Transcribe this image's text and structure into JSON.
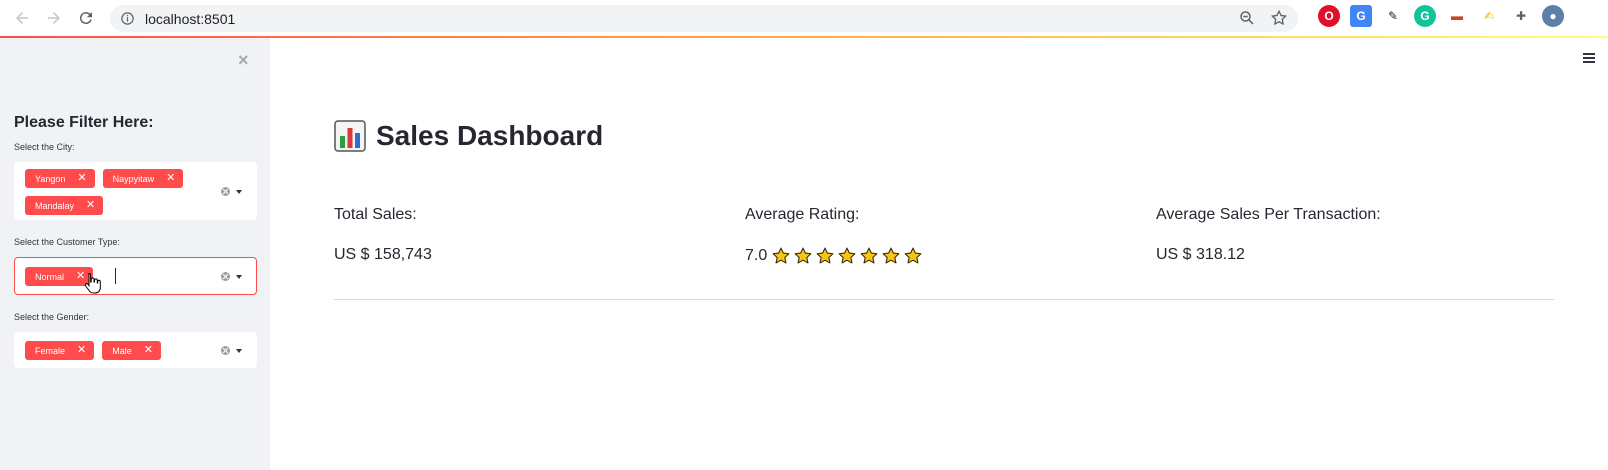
{
  "browser": {
    "url": "localhost:8501"
  },
  "sidebar": {
    "title": "Please Filter Here:",
    "close_icon": "×",
    "filters": [
      {
        "label": "Select the City:",
        "tags": [
          "Yangon",
          "Naypyitaw",
          "Mandalay"
        ]
      },
      {
        "label": "Select the Customer Type:",
        "tags": [
          "Normal"
        ]
      },
      {
        "label": "Select the Gender:",
        "tags": [
          "Female",
          "Male"
        ]
      }
    ]
  },
  "main": {
    "title": "Sales Dashboard",
    "title_icon": "bar-chart-emoji",
    "metrics": [
      {
        "label": "Total Sales:",
        "value": "US $ 158,743"
      },
      {
        "label": "Average Rating:",
        "value": "7.0",
        "stars": 7
      },
      {
        "label": "Average Sales Per Transaction:",
        "value": "US $ 318.12"
      }
    ]
  },
  "colors": {
    "accent": "#ff4b4b",
    "sidebar_bg": "#f0f2f6",
    "star": "#f5c518"
  }
}
